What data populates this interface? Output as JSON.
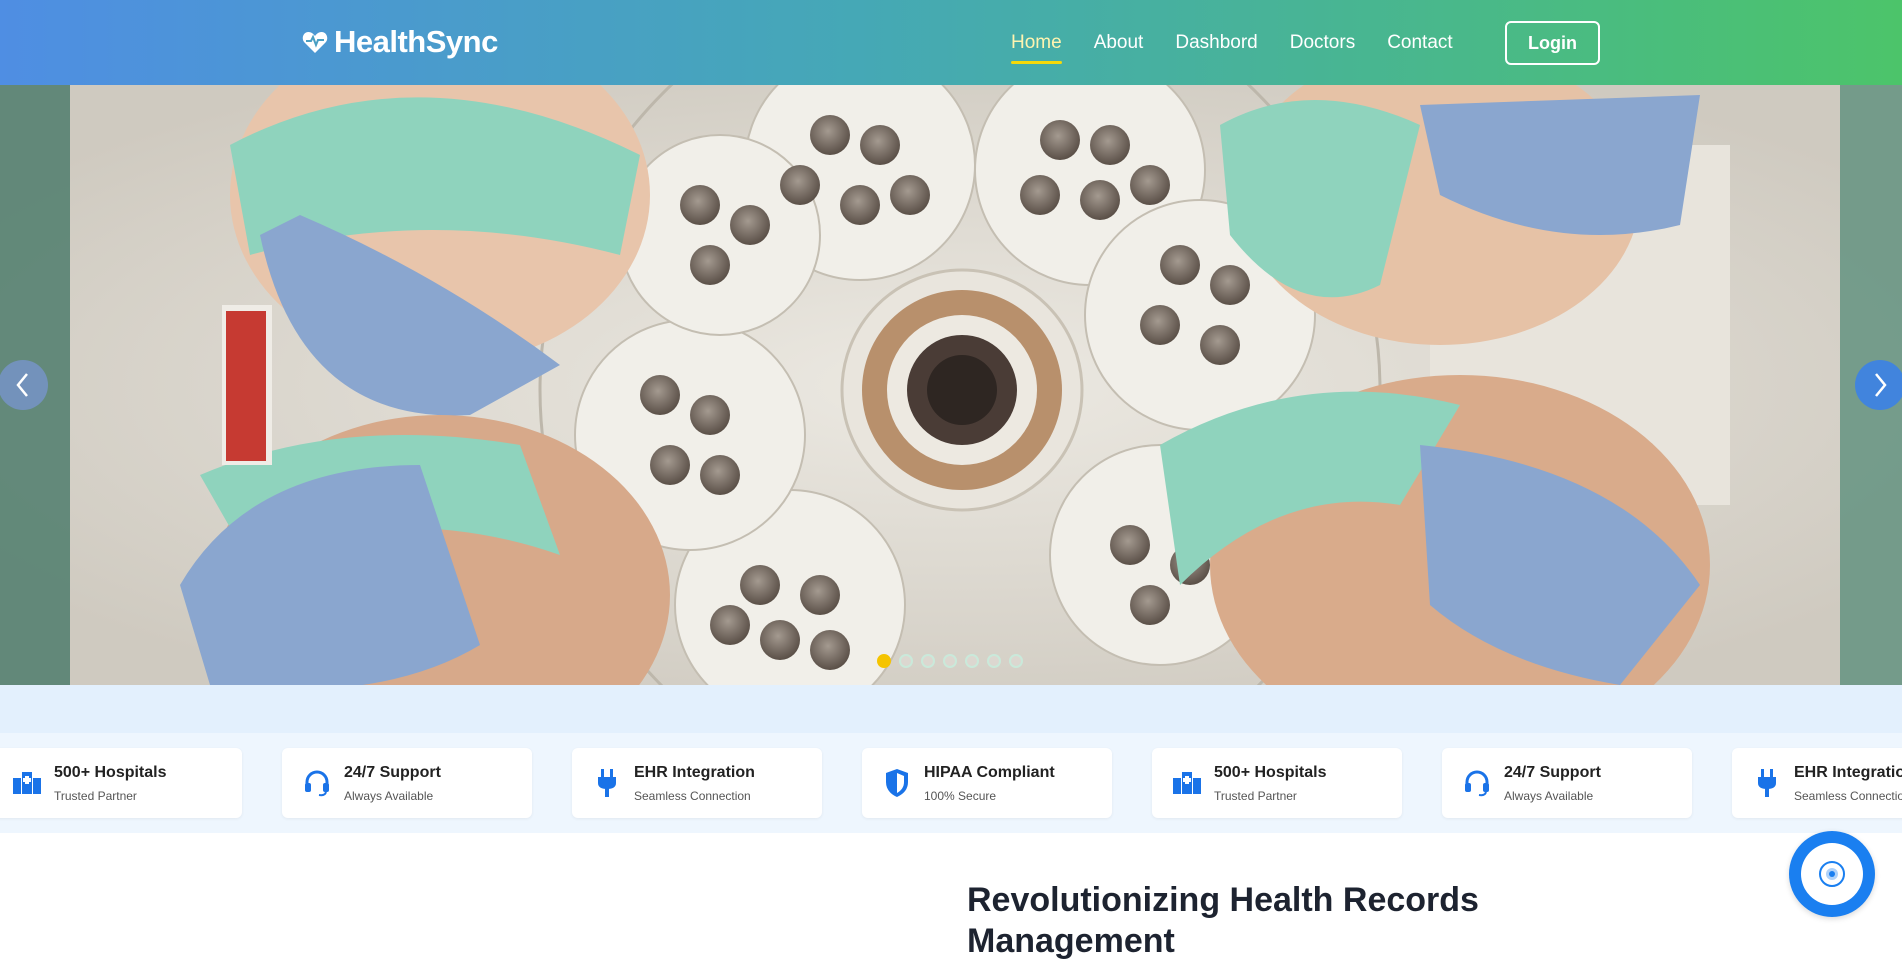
{
  "brand": {
    "name": "HealthSync",
    "icon": "heart-pulse-icon"
  },
  "nav": {
    "links": [
      {
        "label": "Home",
        "active": true
      },
      {
        "label": "About",
        "active": false
      },
      {
        "label": "Dashbord",
        "active": false
      },
      {
        "label": "Doctors",
        "active": false
      },
      {
        "label": "Contact",
        "active": false
      }
    ],
    "login_label": "Login"
  },
  "colors": {
    "nav_gradient_start": "#4f8ee3",
    "nav_gradient_end": "#4cc46a",
    "accent_yellow": "#f5d90a",
    "primary_blue": "#1a7ff0"
  },
  "hero": {
    "image_description": "surgeons-looking-down-operating-light",
    "slide_count": 7,
    "active_slide": 1,
    "prev_icon": "chevron-left-icon",
    "next_icon": "chevron-right-icon"
  },
  "features": [
    {
      "title": "500+ Hospitals",
      "subtitle": "Trusted Partner",
      "icon": "hospital-icon"
    },
    {
      "title": "24/7 Support",
      "subtitle": "Always Available",
      "icon": "headset-icon"
    },
    {
      "title": "EHR Integration",
      "subtitle": "Seamless Connection",
      "icon": "plug-icon"
    },
    {
      "title": "HIPAA Compliant",
      "subtitle": "100% Secure",
      "icon": "shield-icon"
    },
    {
      "title": "500+ Hospitals",
      "subtitle": "Trusted Partner",
      "icon": "hospital-icon"
    },
    {
      "title": "24/7 Support",
      "subtitle": "Always Available",
      "icon": "headset-icon"
    },
    {
      "title": "EHR Integration",
      "subtitle": "Seamless Connection",
      "icon": "plug-icon"
    }
  ],
  "main": {
    "headline": "Revolutionizing Health Records Management"
  },
  "chat": {
    "icon": "chat-bot-icon"
  }
}
